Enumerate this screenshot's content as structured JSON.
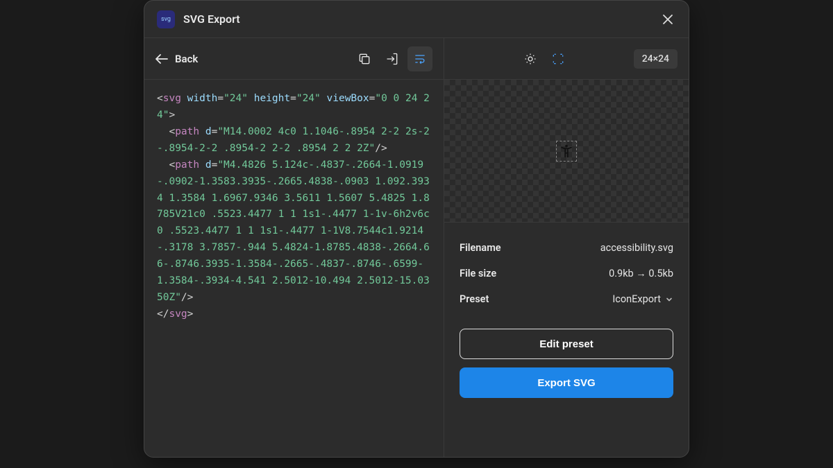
{
  "title": "SVG Export",
  "back_label": "Back",
  "dimensions_badge": "24×24",
  "code": {
    "lines": [
      {
        "type": "open",
        "tag": "svg",
        "attrs": [
          [
            "width",
            "\"24\""
          ],
          [
            "height",
            "\"24\""
          ],
          [
            "viewBox",
            "\"0 0 24 24\""
          ]
        ],
        "self": false
      },
      {
        "type": "open",
        "tag": "path",
        "indent": 1,
        "attrs": [
          [
            "d",
            "\"M14.0002 4c0 1.1046-.8954 2-2 2s-2-.8954-2-2 .8954-2 2-2 .8954 2 2 2Z\""
          ]
        ],
        "self": true
      },
      {
        "type": "open",
        "tag": "path",
        "indent": 1,
        "attrs": [
          [
            "d",
            "\"M4.4826 5.124c-.4837-.2664-1.0919-.0902-1.3583.3935-.2665.4838-.0903 1.092.3934 1.3584 1.6967.9346 3.5611 1.5607 5.4825 1.8785V21c0 .5523.4477 1 1 1s1-.4477 1-1v-6h2v6c0 .5523.4477 1 1 1s1-.4477 1-1V8.7544c1.9214-.3178 3.7857-.944 5.4824-1.8785.4838-.2664.66-.8746.3935-1.3584-.2665-.4837-.8746-.6599-1.3584-.3934-4.541 2.5012-10.494 2.5012-15.0350Z\""
          ]
        ],
        "self": true
      },
      {
        "type": "close",
        "tag": "svg"
      }
    ]
  },
  "props": {
    "filename_label": "Filename",
    "filename_value": "accessibility.svg",
    "filesize_label": "File size",
    "filesize_value": "0.9kb → 0.5kb",
    "preset_label": "Preset",
    "preset_value": "IconExport"
  },
  "actions": {
    "edit_preset": "Edit preset",
    "export_svg": "Export SVG"
  },
  "icons": {
    "copy": "copy-icon",
    "import": "import-icon",
    "wrap": "wrap-icon",
    "brightness": "brightness-icon",
    "fit": "fit-icon"
  }
}
